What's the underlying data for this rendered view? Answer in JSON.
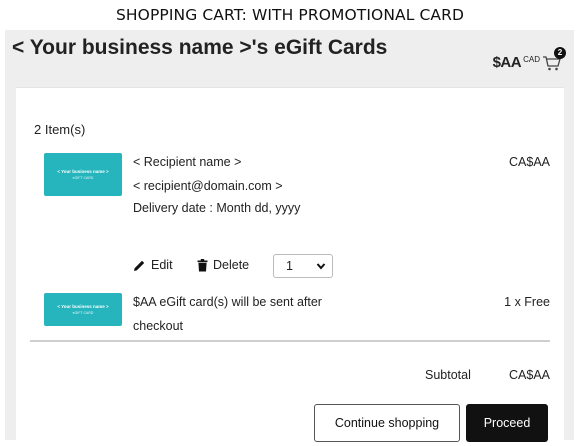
{
  "caption": "SHOPPING CART: WITH PROMOTIONAL CARD",
  "header": {
    "title": "< Your business name >'s eGift Cards",
    "cart_amount": "$AA",
    "cart_currency": "CAD",
    "cart_count": "2"
  },
  "cart": {
    "item_count": "2 Item(s)",
    "items": [
      {
        "card_title": "< Your business name >",
        "card_subtitle": "eGIFT CARD",
        "recipient_name": "< Recipient name >",
        "recipient_email": "< recipient@domain.com >",
        "delivery": "Delivery date : Month dd, yyyy",
        "price": "CA$AA",
        "edit_label": "Edit",
        "delete_label": "Delete",
        "quantity": "1"
      },
      {
        "card_title": "< Your business name >",
        "card_subtitle": "eGIFT CARD",
        "line1": "$AA eGift card(s) will be sent after",
        "line2": "checkout",
        "price": "1 x Free"
      }
    ],
    "subtotal_label": "Subtotal",
    "subtotal_value": "CA$AA"
  },
  "actions": {
    "continue_label": "Continue shopping",
    "proceed_label": "Proceed"
  },
  "colors": {
    "card_teal": "#26b5bd",
    "primary_button": "#111111"
  }
}
